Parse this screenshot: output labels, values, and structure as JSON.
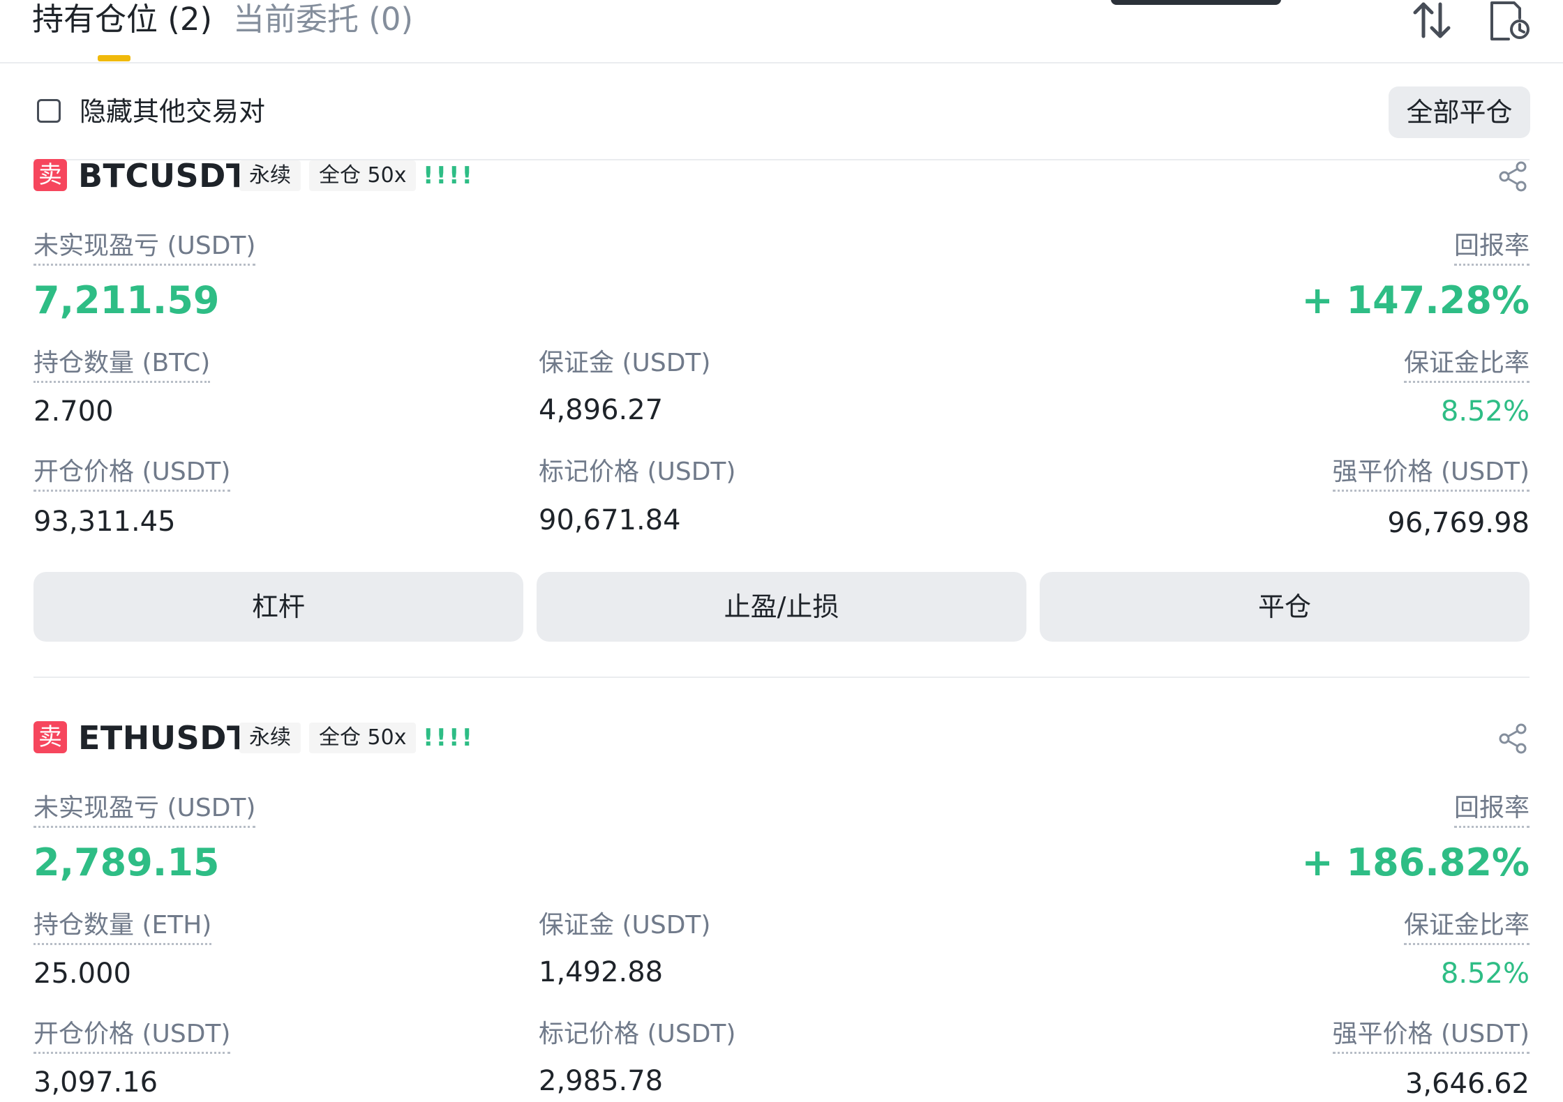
{
  "header": {
    "tab_positions": "持有仓位 (2)",
    "tab_orders": "当前委托 (0)"
  },
  "filter": {
    "hide_other_pairs": "隐藏其他交易对",
    "close_all": "全部平仓"
  },
  "positions": [
    {
      "side": "卖",
      "symbol": "BTCUSDT",
      "contract": "永续",
      "margin_mode": "全仓 50x",
      "signal": "!!!!",
      "pnl_label": "未实现盈亏 (USDT)",
      "pnl_value": "7,211.59",
      "roe_label": "回报率",
      "roe_value": "+ 147.28%",
      "size_label": "持仓数量 (BTC)",
      "size_value": "2.700",
      "margin_label": "保证金 (USDT)",
      "margin_value": "4,896.27",
      "margin_ratio_label": "保证金比率",
      "margin_ratio_value": "8.52%",
      "entry_label": "开仓价格 (USDT)",
      "entry_value": "93,311.45",
      "mark_label": "标记价格 (USDT)",
      "mark_value": "90,671.84",
      "liq_label": "强平价格 (USDT)",
      "liq_value": "96,769.98",
      "btn_leverage": "杠杆",
      "btn_tpsl": "止盈/止损",
      "btn_close": "平仓"
    },
    {
      "side": "卖",
      "symbol": "ETHUSDT",
      "contract": "永续",
      "margin_mode": "全仓 50x",
      "signal": "!!!!",
      "pnl_label": "未实现盈亏 (USDT)",
      "pnl_value": "2,789.15",
      "roe_label": "回报率",
      "roe_value": "+ 186.82%",
      "size_label": "持仓数量 (ETH)",
      "size_value": "25.000",
      "margin_label": "保证金 (USDT)",
      "margin_value": "1,492.88",
      "margin_ratio_label": "保证金比率",
      "margin_ratio_value": "8.52%",
      "entry_label": "开仓价格 (USDT)",
      "entry_value": "3,097.16",
      "mark_label": "标记价格 (USDT)",
      "mark_value": "2,985.78",
      "liq_label": "强平价格 (USDT)",
      "liq_value": "3,646.62"
    }
  ],
  "colors": {
    "profit_green": "#2ebd85",
    "sell_red": "#f6465d",
    "tab_accent": "#f0b90b"
  },
  "icons": [
    "sort-icon",
    "history-icon",
    "share-icon"
  ]
}
